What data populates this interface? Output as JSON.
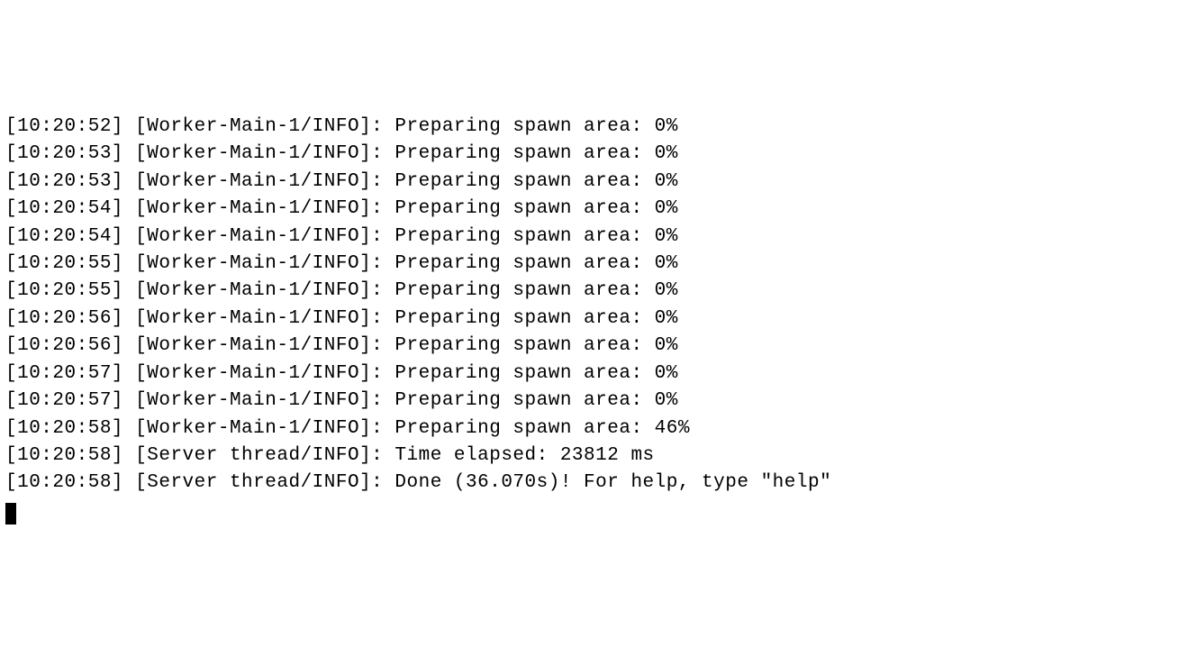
{
  "log": {
    "lines": [
      {
        "timestamp": "[10:20:52]",
        "source": "[Worker-Main-1/INFO]:",
        "message": "Preparing spawn area: 0%"
      },
      {
        "timestamp": "[10:20:53]",
        "source": "[Worker-Main-1/INFO]:",
        "message": "Preparing spawn area: 0%"
      },
      {
        "timestamp": "[10:20:53]",
        "source": "[Worker-Main-1/INFO]:",
        "message": "Preparing spawn area: 0%"
      },
      {
        "timestamp": "[10:20:54]",
        "source": "[Worker-Main-1/INFO]:",
        "message": "Preparing spawn area: 0%"
      },
      {
        "timestamp": "[10:20:54]",
        "source": "[Worker-Main-1/INFO]:",
        "message": "Preparing spawn area: 0%"
      },
      {
        "timestamp": "[10:20:55]",
        "source": "[Worker-Main-1/INFO]:",
        "message": "Preparing spawn area: 0%"
      },
      {
        "timestamp": "[10:20:55]",
        "source": "[Worker-Main-1/INFO]:",
        "message": "Preparing spawn area: 0%"
      },
      {
        "timestamp": "[10:20:56]",
        "source": "[Worker-Main-1/INFO]:",
        "message": "Preparing spawn area: 0%"
      },
      {
        "timestamp": "[10:20:56]",
        "source": "[Worker-Main-1/INFO]:",
        "message": "Preparing spawn area: 0%"
      },
      {
        "timestamp": "[10:20:57]",
        "source": "[Worker-Main-1/INFO]:",
        "message": "Preparing spawn area: 0%"
      },
      {
        "timestamp": "[10:20:57]",
        "source": "[Worker-Main-1/INFO]:",
        "message": "Preparing spawn area: 0%"
      },
      {
        "timestamp": "[10:20:58]",
        "source": "[Worker-Main-1/INFO]:",
        "message": "Preparing spawn area: 46%"
      },
      {
        "timestamp": "[10:20:58]",
        "source": "[Server thread/INFO]:",
        "message": "Time elapsed: 23812 ms"
      },
      {
        "timestamp": "[10:20:58]",
        "source": "[Server thread/INFO]:",
        "message": "Done (36.070s)! For help, type \"help\""
      }
    ]
  }
}
